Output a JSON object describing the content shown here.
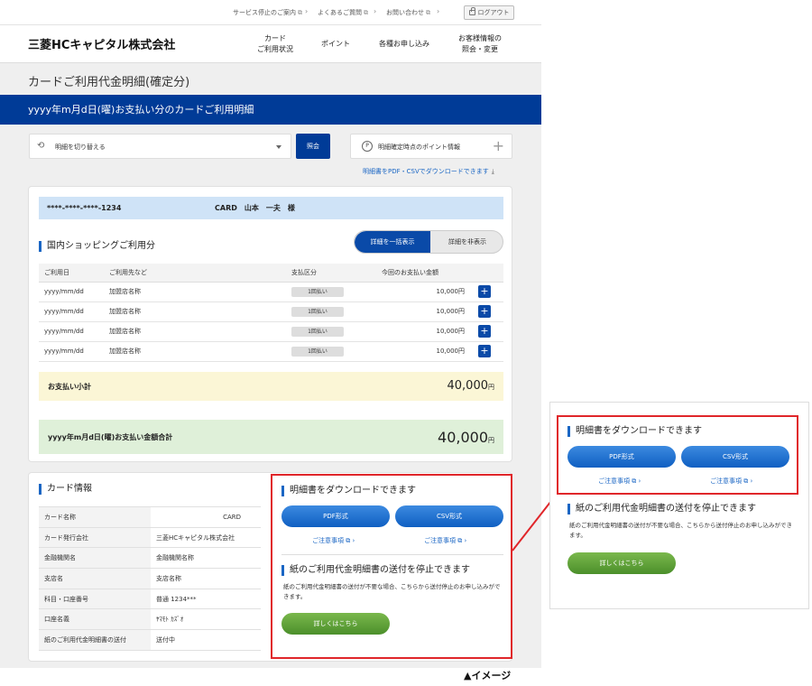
{
  "utility": {
    "links": [
      "サービス停止のご案内",
      "よくあるご質問",
      "お問い合わせ"
    ],
    "logout": "ログアウト"
  },
  "header": {
    "logo": "三菱HCキャピタル株式会社",
    "nav": [
      {
        "line1": "カード",
        "line2": "ご利用状況"
      },
      {
        "line1": "ポイント",
        "line2": ""
      },
      {
        "line1": "各種お申し込み",
        "line2": ""
      },
      {
        "line1": "お客様情報の",
        "line2": "照会・変更"
      }
    ]
  },
  "page_title": "カードご利用代金明細(確定分)",
  "banner": "yyyy年m月d日(曜)お支払い分のカードご利用明細",
  "controls": {
    "switch_label": "明細を切り替える",
    "submit": "照会",
    "points_label": "明細確定時点のポイント情報",
    "download_link": "明細書をPDF・CSVでダウンロードできます"
  },
  "statement": {
    "card_number": "****-****-****-1234",
    "card_name": "CARD　山本　一夫　様",
    "section_title": "国内ショッピングご利用分",
    "toggle_on": "詳細を一括表示",
    "toggle_off": "詳細を非表示",
    "columns": [
      "ご利用日",
      "ご利用先など",
      "支払区分",
      "今回のお支払い金額"
    ],
    "rows": [
      {
        "date": "yyyy/mm/dd",
        "merchant": "加盟店名称",
        "type": "1回払い",
        "amount": "10,000円"
      },
      {
        "date": "yyyy/mm/dd",
        "merchant": "加盟店名称",
        "type": "1回払い",
        "amount": "10,000円"
      },
      {
        "date": "yyyy/mm/dd",
        "merchant": "加盟店名称",
        "type": "1回払い",
        "amount": "10,000円"
      },
      {
        "date": "yyyy/mm/dd",
        "merchant": "加盟店名称",
        "type": "1回払い",
        "amount": "10,000円"
      }
    ],
    "subtotal_label": "お支払い小計",
    "subtotal_value": "40,000",
    "total_label": "yyyy年m月d日(曜)お支払い金額合計",
    "total_value": "40,000",
    "yen": "円"
  },
  "card_info": {
    "title": "カード情報",
    "rows": [
      {
        "k": "カード名称",
        "v": "CARD"
      },
      {
        "k": "カード発行会社",
        "v": "三菱HCキャピタル株式会社"
      },
      {
        "k": "金融機関名",
        "v": "金融機関名称"
      },
      {
        "k": "支店名",
        "v": "支店名称"
      },
      {
        "k": "科目・口座番号",
        "v": "普通 1234***"
      },
      {
        "k": "口座名義",
        "v": "ﾔﾏﾓﾄ ｶｽﾞｵ"
      },
      {
        "k": "紙のご利用代金明細書の送付",
        "v": "送付中"
      }
    ]
  },
  "download": {
    "title": "明細書をダウンロードできます",
    "pdf": "PDF形式",
    "csv": "CSV形式",
    "note": "ご注意事項"
  },
  "stop_mail": {
    "title": "紙のご利用代金明細書の送付を停止できます",
    "text": "紙のご利用代金明細書の送付が不要な場合、こちらから送付停止のお申し込みができます。",
    "button": "詳しくはこちら"
  },
  "caption": "▲イメージ",
  "colors": {
    "brand": "#003b97",
    "highlight": "#e0262a",
    "green": "#4b8f2b"
  }
}
